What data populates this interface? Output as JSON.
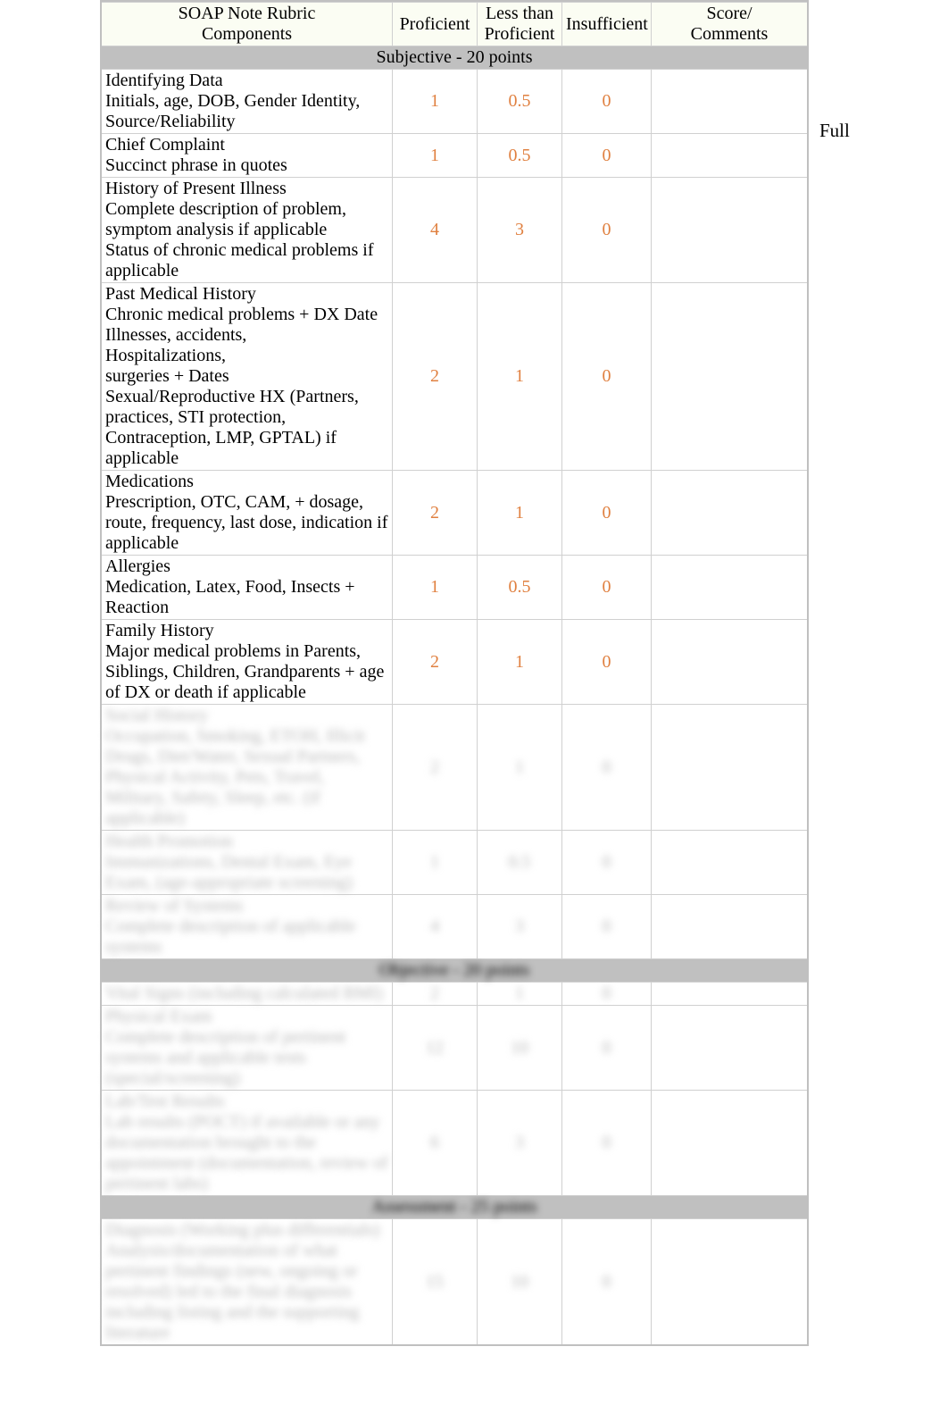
{
  "sideLabel": "Full",
  "headers": {
    "comp_l1": "SOAP Note Rubric",
    "comp_l2": "Components",
    "prof": "Proficient",
    "less_l1": "Less than",
    "less_l2": "Proficient",
    "insuf": "Insufficient",
    "score_l1": "Score/",
    "score_l2": "Comments"
  },
  "sections": [
    {
      "title": "Subjective - 20 points",
      "blur": false
    },
    {
      "title": "Objective - 20 points",
      "blur": true
    },
    {
      "title": "Assessment - 25 points",
      "blur": true
    }
  ],
  "rows": [
    {
      "sec": 0,
      "blur": false,
      "t": "Identifying Data",
      "d": "Initials, age, DOB, Gender Identity, Source/Reliability",
      "p": "1",
      "l": "0.5",
      "i": "0"
    },
    {
      "sec": 0,
      "blur": false,
      "t": "Chief Complaint",
      "d": "Succinct phrase in quotes",
      "p": "1",
      "l": "0.5",
      "i": "0"
    },
    {
      "sec": 0,
      "blur": false,
      "t": "History of Present Illness",
      "d": "Complete description of problem, symptom analysis if applicable\nStatus of chronic medical problems if applicable",
      "p": "4",
      "l": "3",
      "i": "0"
    },
    {
      "sec": 0,
      "blur": false,
      "t": "Past Medical History",
      "d": "Chronic medical problems + DX Date\nIllnesses, accidents,\nHospitalizations,\nsurgeries + Dates\nSexual/Reproductive HX (Partners, practices, STI protection, Contraception, LMP, GPTAL) if applicable",
      "p": "2",
      "l": "1",
      "i": "0"
    },
    {
      "sec": 0,
      "blur": false,
      "t": "Medications",
      "d": "Prescription, OTC, CAM, + dosage, route, frequency, last dose, indication if applicable",
      "p": "2",
      "l": "1",
      "i": "0"
    },
    {
      "sec": 0,
      "blur": false,
      "t": "Allergies",
      "d": "Medication, Latex, Food, Insects + Reaction",
      "p": "1",
      "l": "0.5",
      "i": "0"
    },
    {
      "sec": 0,
      "blur": false,
      "t": " Family History",
      "d": "Major medical problems in Parents, Siblings, Children, Grandparents + age of DX or death if applicable",
      "p": "2",
      "l": "1",
      "i": "0"
    },
    {
      "sec": 0,
      "blur": true,
      "t": "Social History",
      "d": "Occupation, Smoking, ETOH, Illicit Drugs, Diet/Water, Sexual Partners, Physical Activity, Pets, Travel, Military, Safety, Sleep, etc. (if applicable)",
      "p": "2",
      "l": "1",
      "i": "0"
    },
    {
      "sec": 0,
      "blur": true,
      "t": "Health Promotion",
      "d": "Immunizations, Dental Exam, Eye Exam, (age-appropriate screening)",
      "p": "1",
      "l": "0.5",
      "i": "0"
    },
    {
      "sec": 0,
      "blur": true,
      "t": "Review of Systems",
      "d": "Complete description of applicable systems",
      "p": "4",
      "l": "3",
      "i": "0"
    },
    {
      "sec": 1,
      "blur": true,
      "t": "Vital Signs (including calculated BMI)",
      "d": "",
      "p": "2",
      "l": "1",
      "i": "0"
    },
    {
      "sec": 1,
      "blur": true,
      "t": "Physical Exam",
      "d": "Complete description of pertinent systems and applicable tests (special/screening)",
      "p": "12",
      "l": "10",
      "i": "0"
    },
    {
      "sec": 1,
      "blur": true,
      "t": "Lab/Test Results",
      "d": "Lab results (POCT) if available or any documentation brought to the appointment (documentation, review of pertinent labs)",
      "p": "6",
      "l": "3",
      "i": "0"
    },
    {
      "sec": 2,
      "blur": true,
      "t": "Diagnosis (Working plus differentials)",
      "d": "Analysis/documentation of what pertinent findings (new, ongoing or resolved) led to the final diagnosis including listing and the supporting literature",
      "p": "15",
      "l": "10",
      "i": "0"
    }
  ]
}
